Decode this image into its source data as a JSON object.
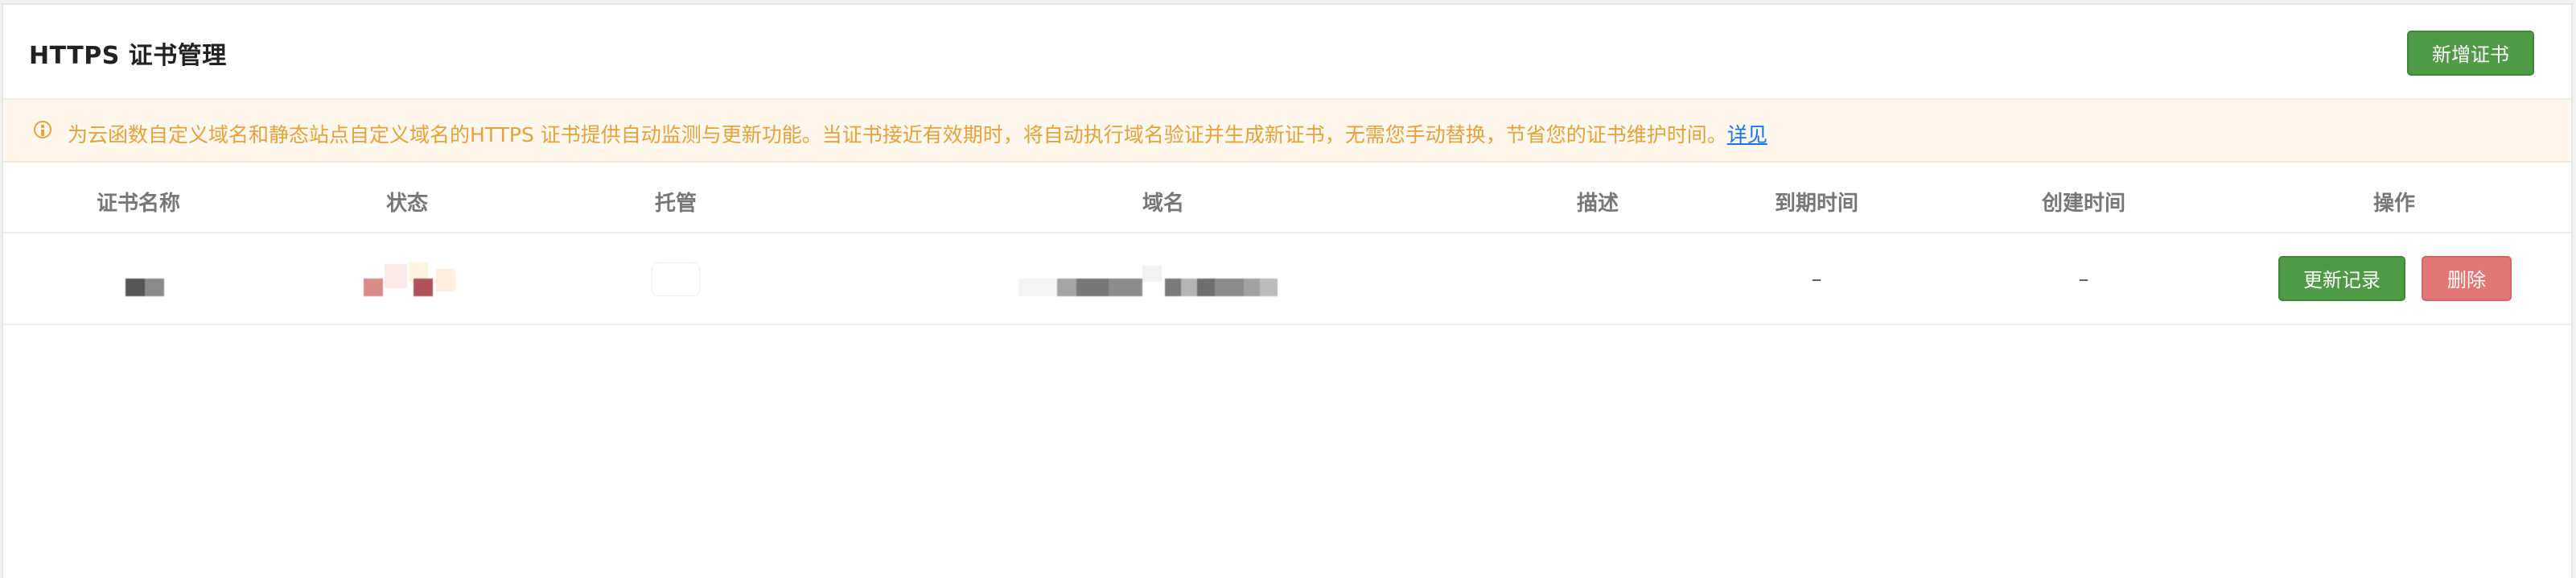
{
  "header": {
    "title": "HTTPS 证书管理",
    "add_button": "新增证书"
  },
  "notice": {
    "text": "为云函数自定义域名和静态站点自定义域名的HTTPS 证书提供自动监测与更新功能。当证书接近有效期时，将自动执行域名验证并生成新证书，无需您手动替换，节省您的证书维护时间。",
    "link": "详见"
  },
  "table": {
    "columns": [
      "证书名称",
      "状态",
      "托管",
      "域名",
      "描述",
      "到期时间",
      "创建时间",
      "操作"
    ],
    "rows": [
      {
        "expire_time": "–",
        "create_time": "–",
        "update_button": "更新记录",
        "delete_button": "删除"
      }
    ]
  },
  "colors": {
    "primary_button": "#4e9a45",
    "danger_button": "#e17775",
    "notice_text": "#e6a23c",
    "link": "#1a73e8"
  },
  "icons": {
    "notice": "info-circle-icon"
  }
}
